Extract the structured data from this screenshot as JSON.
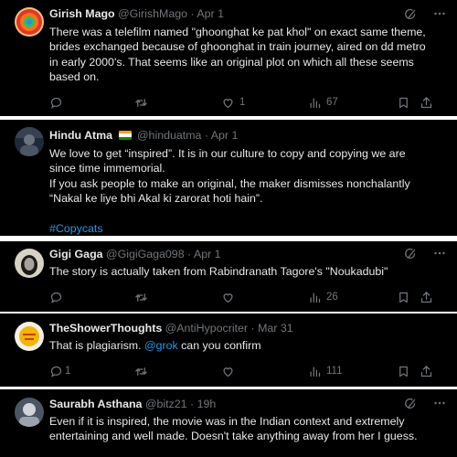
{
  "tweets": [
    {
      "name": "Girish Mago",
      "handle": "@GirishMago",
      "date": "Apr 1",
      "lines": [
        "There was a telefilm named \"ghoonghat ke pat khol\" on exact same theme,",
        "brides exchanged because of ghoonghat in train journey, aired on dd metro",
        "in early 2000's. That seems like an original plot on which all these seems",
        "based on."
      ],
      "likes": "1",
      "views": "67"
    },
    {
      "name": "Hindu Atma",
      "handle": "@hinduatma",
      "date": "Apr 1",
      "lines": [
        "We love to get “inspired”. It is in our culture to copy and copying we are",
        "since time immemorial.",
        "If you ask people to make an original, the maker dismisses nonchalantly",
        "“Nakal ke liye bhi Akal ki zarorat hoti hain”."
      ],
      "hashtag": "#Copycats"
    },
    {
      "name": "Gigi Gaga",
      "handle": "@GigiGaga098",
      "date": "Apr 1",
      "lines": [
        "The story is actually taken from Rabindranath Tagore's \"Noukadubi\""
      ],
      "views": "26"
    },
    {
      "name": "TheShowerThoughts",
      "handle": "@AntiHypocriter",
      "date": "Mar 31",
      "text_before": "That is plagiarism. ",
      "mention": "@grok",
      "text_after": " can you confirm",
      "replies": "1",
      "views": "111"
    },
    {
      "name": "Saurabh Asthana",
      "handle": "@bitz21",
      "date": "19h",
      "lines": [
        "Even if it is inspired, the movie was in the Indian context and extremely",
        "entertaining and well made. Doesn't take anything away from her I guess."
      ]
    }
  ],
  "separator": " · ",
  "icons": [
    "reply-icon",
    "repost-icon",
    "like-icon",
    "views-icon",
    "bookmark-icon",
    "share-icon",
    "grok-icon",
    "more-icon",
    "india-flag-icon"
  ],
  "colors": {
    "background": "#000000",
    "text": "#e7e9ea",
    "muted": "#71767b",
    "link": "#1d9bf0",
    "gap": "#ffffff"
  }
}
